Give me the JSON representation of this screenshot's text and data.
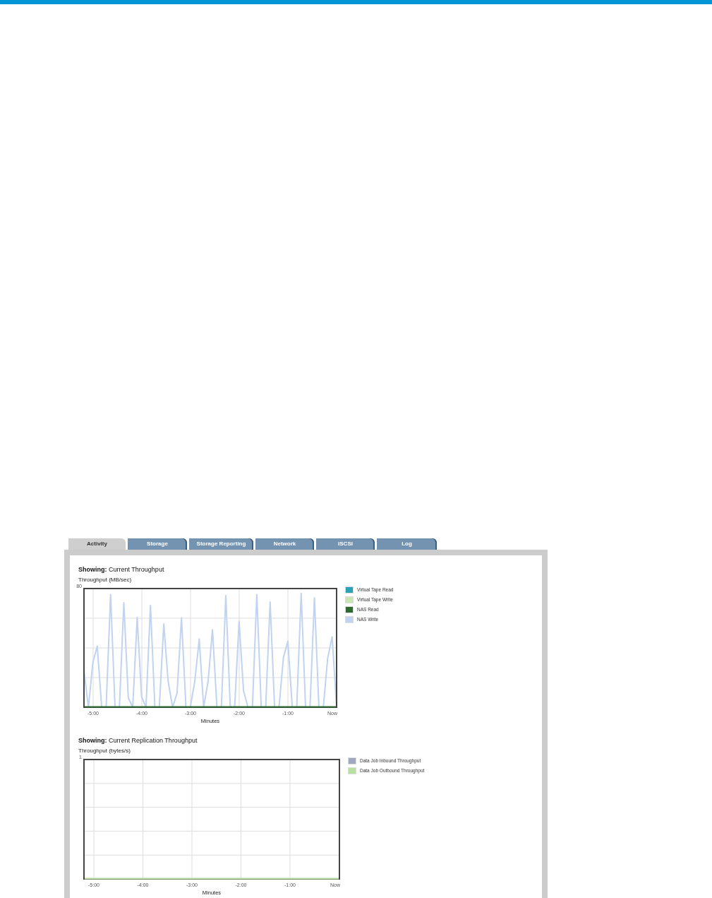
{
  "tabs": [
    {
      "label": "Activity",
      "selected": true
    },
    {
      "label": "Storage",
      "selected": false
    },
    {
      "label": "Storage Reporting",
      "selected": false
    },
    {
      "label": "Network",
      "selected": false
    },
    {
      "label": "iSCSI",
      "selected": false
    },
    {
      "label": "Log",
      "selected": false
    }
  ],
  "charts": [
    {
      "heading": "**Showing:** Current Throughput",
      "y_axis_title": "Throughput (MB/sec)",
      "y_axis_top_label": "80",
      "x_tick_labels": [
        "-5:00",
        "-4:00",
        "-3:00",
        "-2:00",
        "-1:00",
        "Now"
      ],
      "x_axis_title": "Minutes",
      "legend": [
        {
          "label": "Virtual Tape Read",
          "color": "#2aa3b5"
        },
        {
          "label": "Virtual Tape Write",
          "color": "#c8e6b4"
        },
        {
          "label": "NAS Read",
          "color": "#2d6a2f"
        },
        {
          "label": "NAS Write",
          "color": "#c0d3f0"
        }
      ]
    },
    {
      "heading": "**Showing:** Current Replication Throughput",
      "y_axis_title": "Throughput (bytes/s)",
      "y_axis_top_label": "1",
      "x_tick_labels": [
        "-5:00",
        "-4:00",
        "-3:00",
        "-2:00",
        "-1:00",
        "Now"
      ],
      "x_axis_title": "Minutes",
      "legend": [
        {
          "label": "Data Job Inbound Throughput",
          "color": "#a0a8c0"
        },
        {
          "label": "Data Job Outbound Throughput",
          "color": "#b8e0a0"
        }
      ]
    }
  ]
}
